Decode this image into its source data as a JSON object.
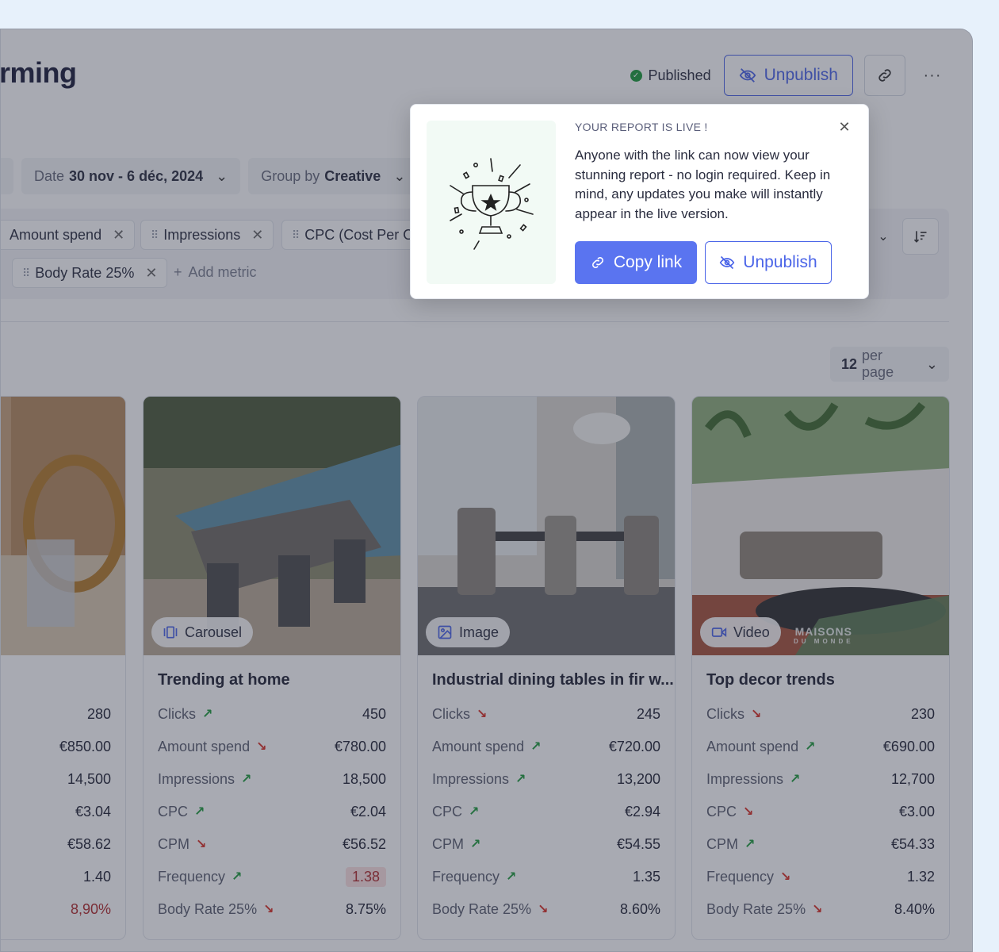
{
  "header": {
    "title": "rming",
    "status": "Published",
    "unpublish_label": "Unpublish",
    "more_label": "···"
  },
  "filters": {
    "date_prefix": "Date",
    "date_value": "30 nov - 6 déc, 2024",
    "group_prefix": "Group by",
    "group_value": "Creative"
  },
  "metrics": [
    {
      "label": "Amount spend"
    },
    {
      "label": "Impressions"
    },
    {
      "label": "CPC (Cost Per O"
    },
    {
      "label": "Body Rate 25%"
    }
  ],
  "add_metric_label": "Add metric",
  "per_page": {
    "value": "12",
    "suffix": "per page"
  },
  "popup": {
    "title": "YOUR REPORT IS LIVE !",
    "body": "Anyone with the link can now view your stunning report - no login required. Keep in mind, any updates you make will instantly appear in the live version.",
    "copy_label": "Copy link",
    "unpublish_label": "Unpublish"
  },
  "cards": [
    {
      "type": "",
      "name": ".",
      "rows": [
        {
          "label": "",
          "trend": "",
          "value": "280"
        },
        {
          "label": "",
          "trend": "",
          "value": "€850.00"
        },
        {
          "label": "",
          "trend": "",
          "value": "14,500"
        },
        {
          "label": "",
          "trend": "",
          "value": "€3.04"
        },
        {
          "label": "",
          "trend": "",
          "value": "€58.62"
        },
        {
          "label": "",
          "trend": "",
          "value": "1.40"
        },
        {
          "label": "",
          "trend": "",
          "value": "8,90%"
        }
      ]
    },
    {
      "type": "Carousel",
      "name": "Trending at home",
      "rows": [
        {
          "label": "Clicks",
          "trend": "up",
          "value": "450"
        },
        {
          "label": "Amount spend",
          "trend": "down",
          "value": "€780.00"
        },
        {
          "label": "Impressions",
          "trend": "up",
          "value": "18,500"
        },
        {
          "label": "CPC",
          "trend": "up",
          "value": "€2.04"
        },
        {
          "label": "CPM",
          "trend": "down",
          "value": "€56.52"
        },
        {
          "label": "Frequency",
          "trend": "up",
          "value": "1.38"
        },
        {
          "label": "Body Rate 25%",
          "trend": "down",
          "value": "8.75%"
        }
      ]
    },
    {
      "type": "Image",
      "name": "Industrial dining tables in fir w...",
      "rows": [
        {
          "label": "Clicks",
          "trend": "down",
          "value": "245"
        },
        {
          "label": "Amount spend",
          "trend": "up",
          "value": "€720.00"
        },
        {
          "label": "Impressions",
          "trend": "up",
          "value": "13,200"
        },
        {
          "label": "CPC",
          "trend": "up",
          "value": "€2.94"
        },
        {
          "label": "CPM",
          "trend": "up",
          "value": "€54.55"
        },
        {
          "label": "Frequency",
          "trend": "up",
          "value": "1.35"
        },
        {
          "label": "Body Rate 25%",
          "trend": "down",
          "value": "8.60%"
        }
      ]
    },
    {
      "type": "Video",
      "name": "Top decor trends",
      "watermark": "MAISONS",
      "watermark_sub": "DU MONDE",
      "rows": [
        {
          "label": "Clicks",
          "trend": "down",
          "value": "230"
        },
        {
          "label": "Amount spend",
          "trend": "up",
          "value": "€690.00"
        },
        {
          "label": "Impressions",
          "trend": "up",
          "value": "12,700"
        },
        {
          "label": "CPC",
          "trend": "down",
          "value": "€3.00"
        },
        {
          "label": "CPM",
          "trend": "up",
          "value": "€54.33"
        },
        {
          "label": "Frequency",
          "trend": "down",
          "value": "1.32"
        },
        {
          "label": "Body Rate 25%",
          "trend": "down",
          "value": "8.40%"
        }
      ]
    }
  ],
  "trend_icons": {
    "up": "↗",
    "down": "↘"
  }
}
